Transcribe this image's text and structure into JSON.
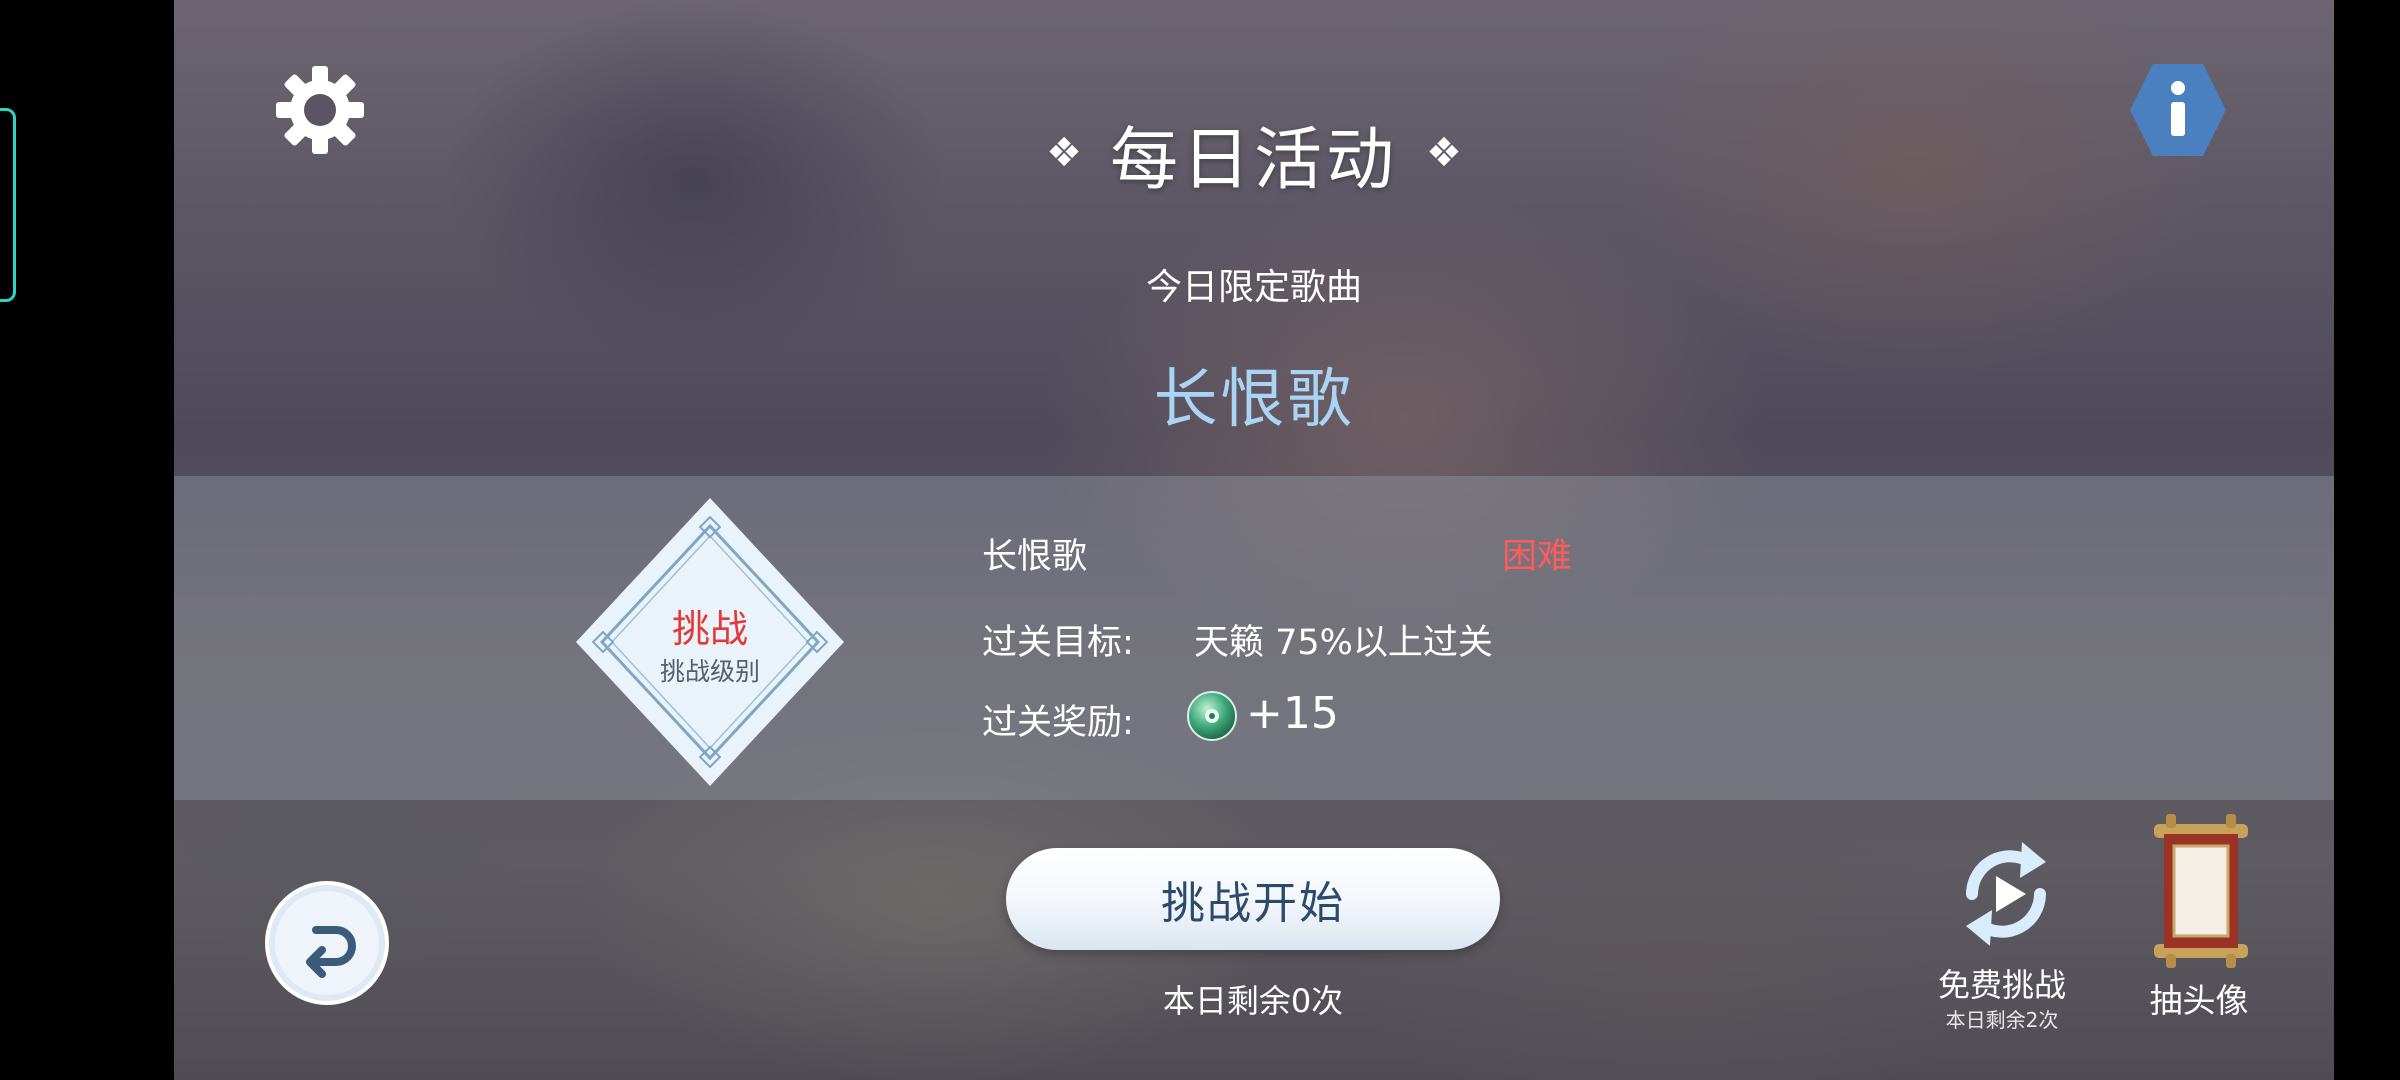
{
  "header": {
    "title": "每日活动",
    "title_deco_left": "❖",
    "title_deco_right": "❖",
    "subtitle": "今日限定歌曲",
    "featured_song": "长恨歌"
  },
  "challenge_panel": {
    "badge_main": "挑战",
    "badge_sub": "挑战级别",
    "song_name": "长恨歌",
    "difficulty": "困难",
    "goal_label": "过关目标:",
    "goal_value": "天籁 75%以上过关",
    "reward_label": "过关奖励:",
    "reward_value": "+15"
  },
  "actions": {
    "start_label": "挑战开始",
    "remaining_today": "本日剩余0次",
    "free_challenge_label": "免费挑战",
    "free_challenge_sub": "本日剩余2次",
    "draw_avatar_label": "抽头像"
  },
  "icons": {
    "settings": "gear-icon",
    "info": "info-icon",
    "back": "return-arrow-icon",
    "reward": "green-disc-icon",
    "free_challenge": "replay-icon",
    "draw_avatar": "scroll-icon"
  },
  "colors": {
    "featured_song": "#a9d4f5",
    "difficulty": "#ff5b5b",
    "badge_main": "#e23a3a",
    "info_badge": "#4a7fc0",
    "edge_indicator": "#2fd3c4"
  }
}
